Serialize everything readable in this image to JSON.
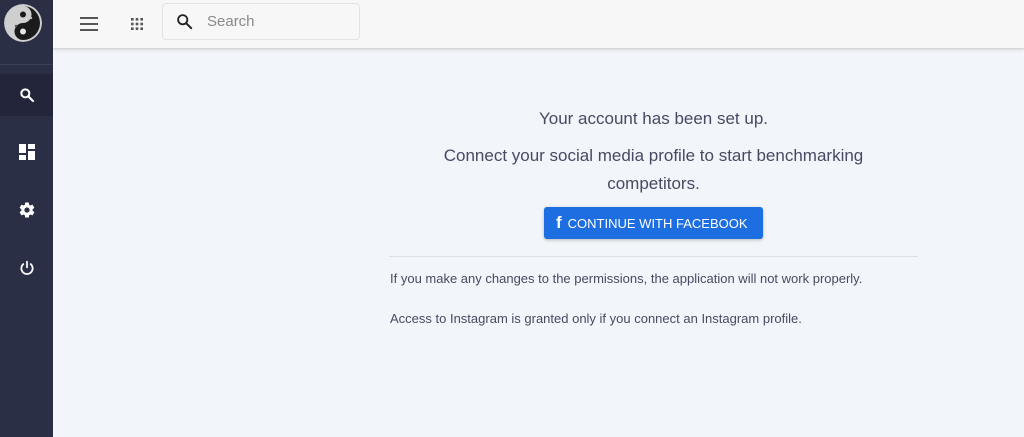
{
  "topbar": {
    "menu_icon": "hamburger-menu-icon",
    "apps_icon": "apps-grid-icon",
    "search": {
      "icon": "search-icon",
      "placeholder": "Search",
      "value": ""
    }
  },
  "sidebar": {
    "logo": "yin-yang-logo",
    "items": [
      {
        "icon": "search-icon",
        "active": true
      },
      {
        "icon": "dashboard-icon",
        "active": false
      },
      {
        "icon": "settings-gear-icon",
        "active": false
      },
      {
        "icon": "power-icon",
        "active": false
      }
    ]
  },
  "main": {
    "message_title": "Your account has been set up.",
    "message_body": "Connect your social media profile to start benchmarking competitors.",
    "facebook_button": {
      "icon": "f",
      "label": "CONTINUE WITH FACEBOOK"
    },
    "note_permissions": "If you make any changes to the permissions, the application will not work properly.",
    "note_instagram": "Access to Instagram is granted only if you connect an Instagram profile."
  },
  "colors": {
    "sidebar_bg": "#2b2f45",
    "sidebar_active": "#23263a",
    "page_bg": "#f2f5f9",
    "facebook_blue": "#1d6ee0",
    "text": "#474a63"
  }
}
